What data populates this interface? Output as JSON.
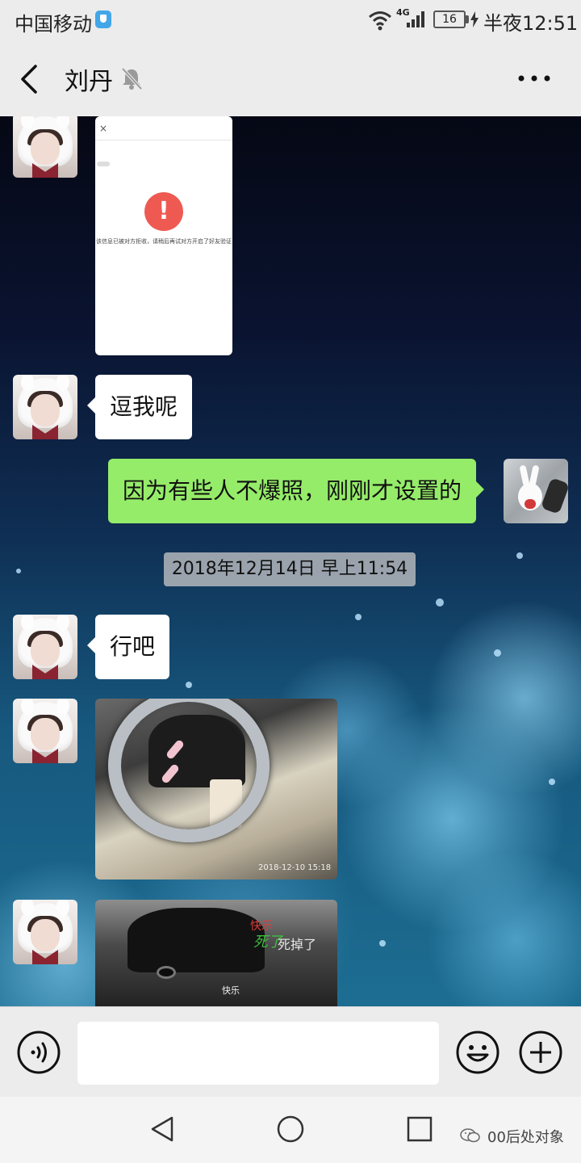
{
  "status_bar": {
    "carrier": "中国移动",
    "network": "4G",
    "battery": "16",
    "time": "半夜12:51"
  },
  "header": {
    "title": "刘丹",
    "icons": [
      "back-icon",
      "mute-icon",
      "more-icon"
    ]
  },
  "chat": {
    "messages": [
      {
        "from": "contact",
        "type": "image",
        "caption_text": "该信息已被对方拒收，请稍后再试对方开启了好友验证",
        "close_glyph": "×",
        "alert_glyph": "!"
      },
      {
        "from": "contact",
        "type": "text",
        "text": "逗我呢"
      },
      {
        "from": "me",
        "type": "text",
        "text": "因为有些人不爆照，刚刚才设置的"
      },
      {
        "type": "timestamp",
        "text": "2018年12月14日 早上11:54"
      },
      {
        "from": "contact",
        "type": "text",
        "text": "行吧"
      },
      {
        "from": "contact",
        "type": "image",
        "photo_stamp": "2018-12-10 15:18"
      },
      {
        "from": "contact",
        "type": "image",
        "overlay_texts": [
          "快乐",
          "死了",
          "死掉了",
          "快乐"
        ]
      }
    ]
  },
  "input_bar": {
    "placeholder": "",
    "icons": [
      "voice-icon",
      "emoji-icon",
      "plus-icon"
    ]
  },
  "nav_bar": {
    "icons": [
      "nav-back-icon",
      "nav-home-icon",
      "nav-recent-icon"
    ],
    "watermark": "00后处对象"
  },
  "colors": {
    "outgoing_bubble": "#95ec69",
    "incoming_bubble": "#ffffff",
    "alert_red": "#ee5a52"
  }
}
